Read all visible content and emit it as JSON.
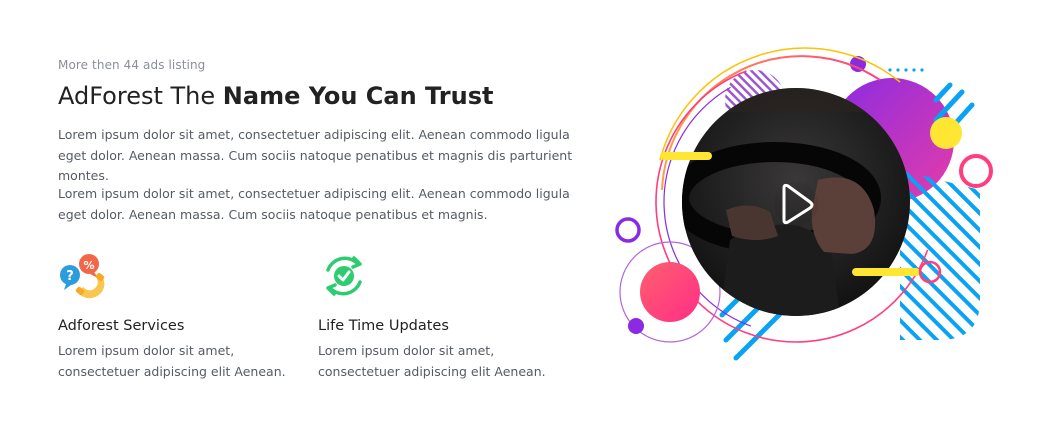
{
  "section": {
    "kicker": "More then 44 ads listing",
    "title_light": "AdForest The ",
    "title_bold": "Name You Can Trust",
    "paragraph_1": "Lorem ipsum dolor sit amet, consectetuer adipiscing elit. Aenean commodo ligula eget dolor. Aenean massa. Cum sociis natoque penatibus et magnis dis parturient montes.",
    "paragraph_2": "Lorem ipsum dolor sit amet, consectetuer adipiscing elit. Aenean commodo ligula eget dolor. Aenean massa. Cum sociis natoque penatibus et magnis."
  },
  "features": [
    {
      "icon": "support-phone-icon",
      "title": "Adforest Services",
      "description": "Lorem ipsum dolor sit amet, consectetuer adipiscing elit Aenean."
    },
    {
      "icon": "refresh-check-icon",
      "title": "Life Time Updates",
      "description": "Lorem ipsum dolor sit amet, consectetuer adipiscing elit Aenean."
    }
  ],
  "media": {
    "icon": "play-icon",
    "colors": {
      "pink": "#ff3d7f",
      "purple": "#8a2be2",
      "blue": "#0aa2f5",
      "yellow": "#ffe633",
      "magenta": "#e63ca8"
    }
  }
}
